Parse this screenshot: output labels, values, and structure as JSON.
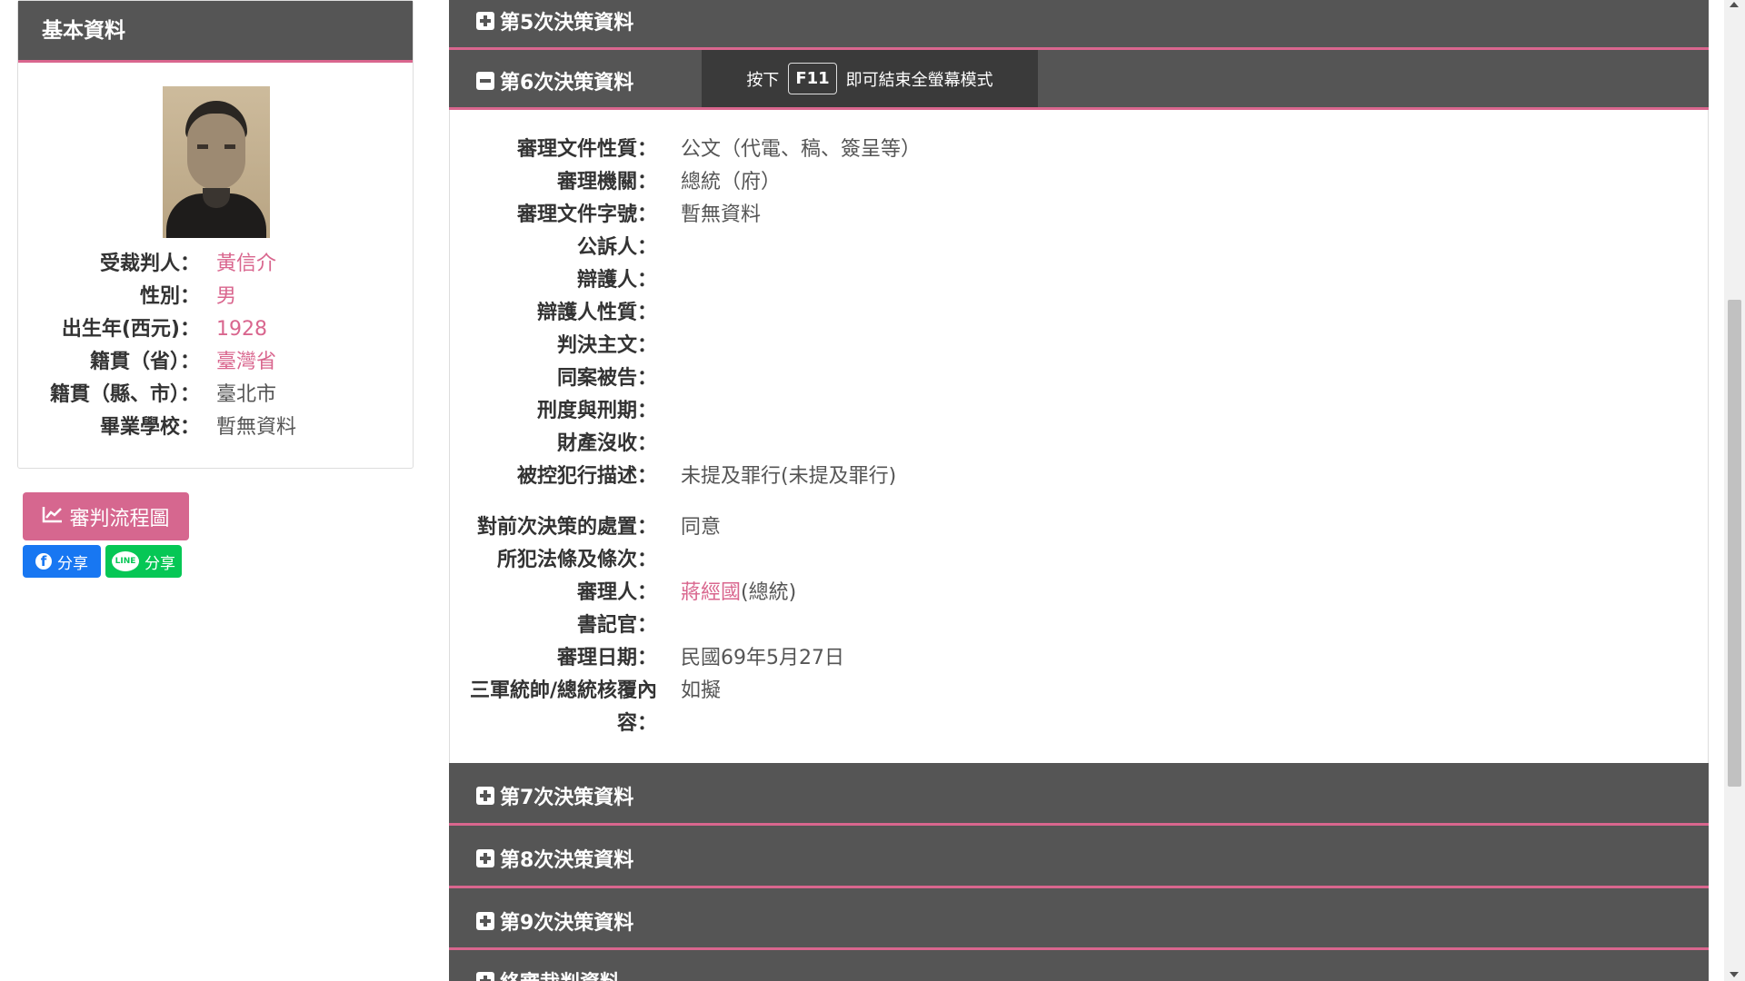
{
  "sidebar": {
    "header": "基本資料",
    "photo_alt": "受裁判人照片",
    "fields": [
      {
        "label": "受裁判人：",
        "value": "黃信介",
        "style": "pink"
      },
      {
        "label": "性別：",
        "value": "男",
        "style": "pink"
      },
      {
        "label": "出生年(西元)：",
        "value": "1928",
        "style": "pink"
      },
      {
        "label": "籍貫（省）：",
        "value": "臺灣省",
        "style": "pink"
      },
      {
        "label": "籍貫（縣、市）：",
        "value": "臺北市",
        "style": "grey"
      },
      {
        "label": "畢業學校：",
        "value": "暫無資料",
        "style": "grey"
      }
    ],
    "flow_button": "審判流程圖",
    "share_facebook": "分享",
    "share_line": "分享",
    "line_logo_text": "LINE",
    "facebook_logo_text": "f"
  },
  "sections": {
    "s5": "第5次決策資料",
    "s6": "第6次決策資料",
    "s7": "第7次決策資料",
    "s8": "第8次決策資料",
    "s9": "第9次決策資料",
    "final": "終審裁判資料"
  },
  "fullscreen_notice": {
    "prefix": "按下",
    "key": "F11",
    "suffix": "即可結束全螢幕模式"
  },
  "decision6": {
    "rows": [
      {
        "label": "審理文件性質：",
        "value": "公文（代電、稿、簽呈等）"
      },
      {
        "label": "審理機關：",
        "value": "總統（府）"
      },
      {
        "label": "審理文件字號：",
        "value": "暫無資料"
      },
      {
        "label": "公訴人：",
        "value": ""
      },
      {
        "label": "辯護人：",
        "value": ""
      },
      {
        "label": "辯護人性質：",
        "value": ""
      },
      {
        "label": "判決主文：",
        "value": ""
      },
      {
        "label": "同案被告：",
        "value": ""
      },
      {
        "label": "刑度與刑期：",
        "value": ""
      },
      {
        "label": "財產沒收：",
        "value": ""
      },
      {
        "label": "被控犯行描述：",
        "value": "未提及罪行(未提及罪行)"
      },
      {
        "label": "對前次決策的處置：",
        "value": "同意"
      },
      {
        "label": "所犯法條及條次：",
        "value": ""
      },
      {
        "label": "審理人：",
        "value_link": "蔣經國",
        "value_suffix": "(總統)"
      },
      {
        "label": "書記官：",
        "value": ""
      },
      {
        "label": "審理日期：",
        "value": "民國69年5月27日"
      },
      {
        "label_line1": "三軍統帥/總統核覆內",
        "label_line2": "容：",
        "value": "如擬"
      }
    ]
  },
  "colors": {
    "accent_pink": "#d9668e",
    "header_bg": "#555555",
    "facebook": "#1877f2",
    "line": "#06c755"
  }
}
